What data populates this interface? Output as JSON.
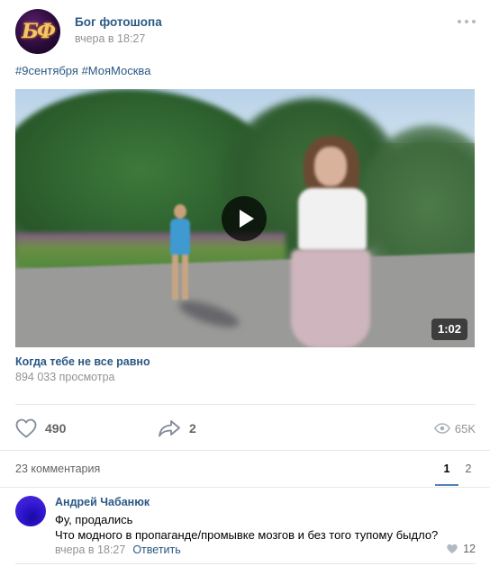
{
  "post": {
    "author": "Бог фотошопа",
    "avatar_initials": "БФ",
    "time": "вчера в 18:27",
    "hashtags": [
      "#9сентября",
      "#МояМосква"
    ]
  },
  "video": {
    "duration": "1:02",
    "title": "Когда тебе не все равно",
    "views": "894 033 просмотра"
  },
  "actions": {
    "likes": "490",
    "comments": "23",
    "shares": "2",
    "views": "65K"
  },
  "comments": {
    "count_label": "23 комментария",
    "pages": [
      "1",
      "2"
    ],
    "active_page": "1",
    "items": [
      {
        "author": "Андрей Чабанюк",
        "text_line1": "Фу, продались",
        "text_line2": "Что модного в пропаганде/промывке мозгов и без того тупому быдло?",
        "time": "вчера в 18:27",
        "reply_label": "Ответить",
        "likes": "12"
      }
    ]
  },
  "colors": {
    "link": "#2a5885",
    "muted": "#939393",
    "icon": "#828a99",
    "accent": "#5181b8"
  },
  "icons": [
    "more-icon",
    "play-icon",
    "heart-icon",
    "comment-icon",
    "share-icon",
    "eye-icon",
    "small-heart-icon"
  ]
}
